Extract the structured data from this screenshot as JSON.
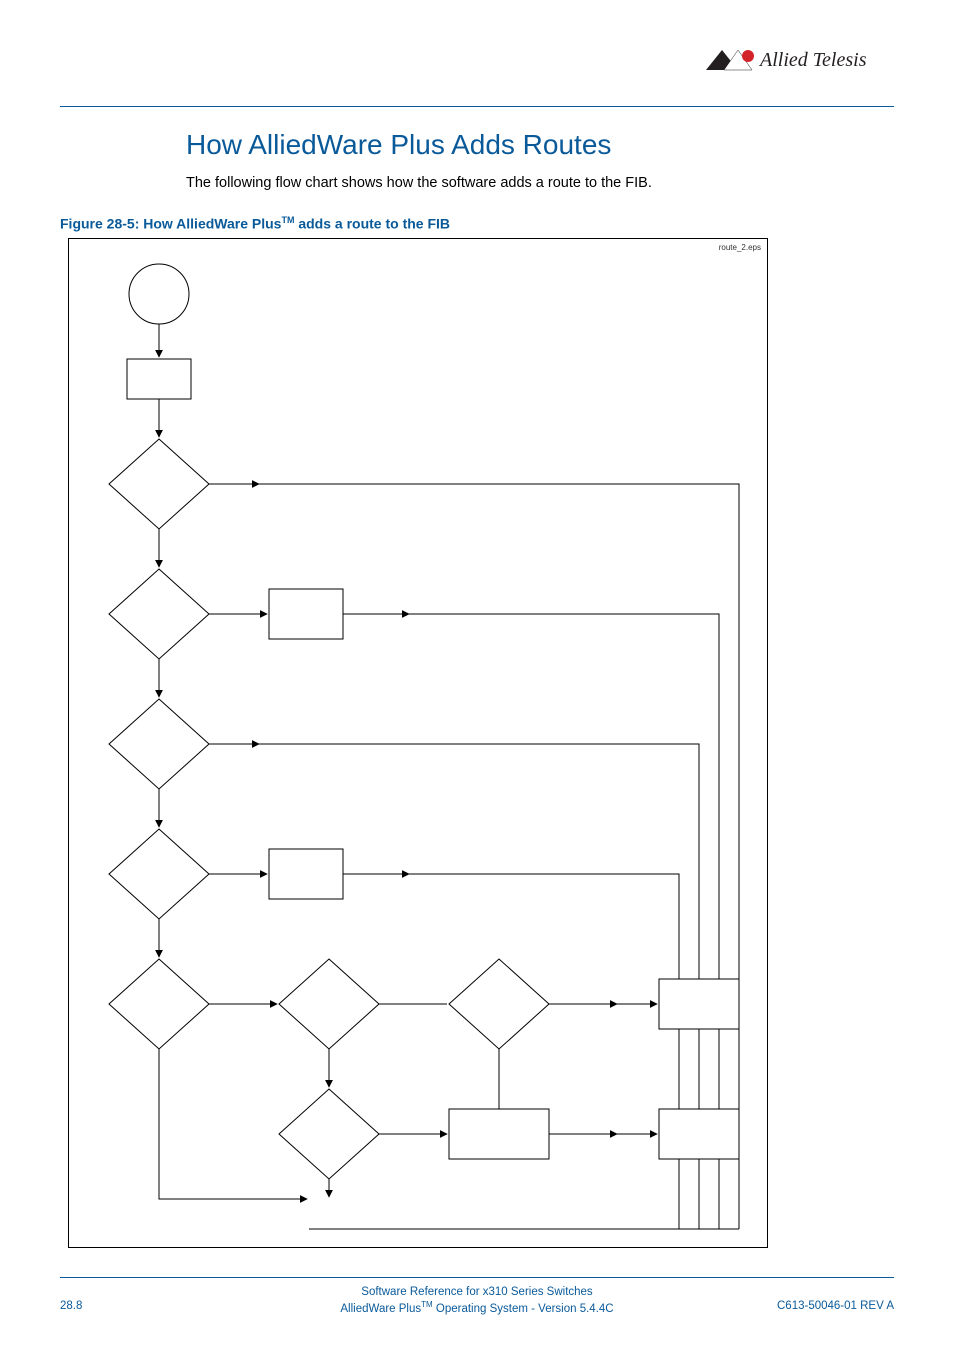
{
  "brand": "Allied Telesis",
  "section_title": "How AlliedWare Plus Adds Routes",
  "intro_text": "The following flow chart shows how the software adds a route to the FIB.",
  "figure_caption_prefix": "Figure 28-5: How AlliedWare Plus",
  "figure_caption_tm": "TM",
  "figure_caption_suffix": " adds a route to the FIB",
  "eps_label": "route_2.eps",
  "footer_line1": "Software Reference for x310 Series Switches",
  "footer_page": "28.8",
  "footer_center_a": "AlliedWare Plus",
  "footer_center_tm": "TM",
  "footer_center_b": " Operating System  - Version 5.4.4C",
  "footer_rev": "C613-50046-01 REV A",
  "chart_data": {
    "type": "flowchart",
    "title": "How AlliedWare Plus adds a route to the FIB",
    "nodes": [
      {
        "id": "start",
        "shape": "circle"
      },
      {
        "id": "p1",
        "shape": "process"
      },
      {
        "id": "d1",
        "shape": "decision"
      },
      {
        "id": "d2",
        "shape": "decision"
      },
      {
        "id": "p2",
        "shape": "process"
      },
      {
        "id": "d3",
        "shape": "decision"
      },
      {
        "id": "d4",
        "shape": "decision"
      },
      {
        "id": "p4",
        "shape": "process"
      },
      {
        "id": "d5",
        "shape": "decision"
      },
      {
        "id": "d6",
        "shape": "decision"
      },
      {
        "id": "d7",
        "shape": "decision"
      },
      {
        "id": "d8",
        "shape": "decision"
      },
      {
        "id": "p5",
        "shape": "process"
      },
      {
        "id": "p6",
        "shape": "process"
      },
      {
        "id": "end",
        "shape": "terminator"
      }
    ],
    "edges": [
      {
        "from": "start",
        "to": "p1"
      },
      {
        "from": "p1",
        "to": "d1"
      },
      {
        "from": "d1",
        "to": "d2",
        "label": ""
      },
      {
        "from": "d1",
        "to": "end",
        "label": "",
        "path": "right-loop"
      },
      {
        "from": "d2",
        "to": "d3"
      },
      {
        "from": "d2",
        "to": "p2"
      },
      {
        "from": "p2",
        "to": "end",
        "path": "right-loop"
      },
      {
        "from": "d3",
        "to": "d4"
      },
      {
        "from": "d3",
        "to": "end",
        "path": "right-loop"
      },
      {
        "from": "d4",
        "to": "d5"
      },
      {
        "from": "d4",
        "to": "p4"
      },
      {
        "from": "p4",
        "to": "end",
        "path": "right-loop"
      },
      {
        "from": "d5",
        "to": "end",
        "path": "left-bottom"
      },
      {
        "from": "d5",
        "to": "d6"
      },
      {
        "from": "d6",
        "to": "d8"
      },
      {
        "from": "d6",
        "to": "d7"
      },
      {
        "from": "d7",
        "to": "p6"
      },
      {
        "from": "d8",
        "to": "end",
        "path": "left-bottom"
      },
      {
        "from": "d8",
        "to": "p5"
      },
      {
        "from": "p5",
        "to": "p6"
      },
      {
        "from": "p6",
        "to": "end",
        "path": "right-short"
      }
    ]
  }
}
